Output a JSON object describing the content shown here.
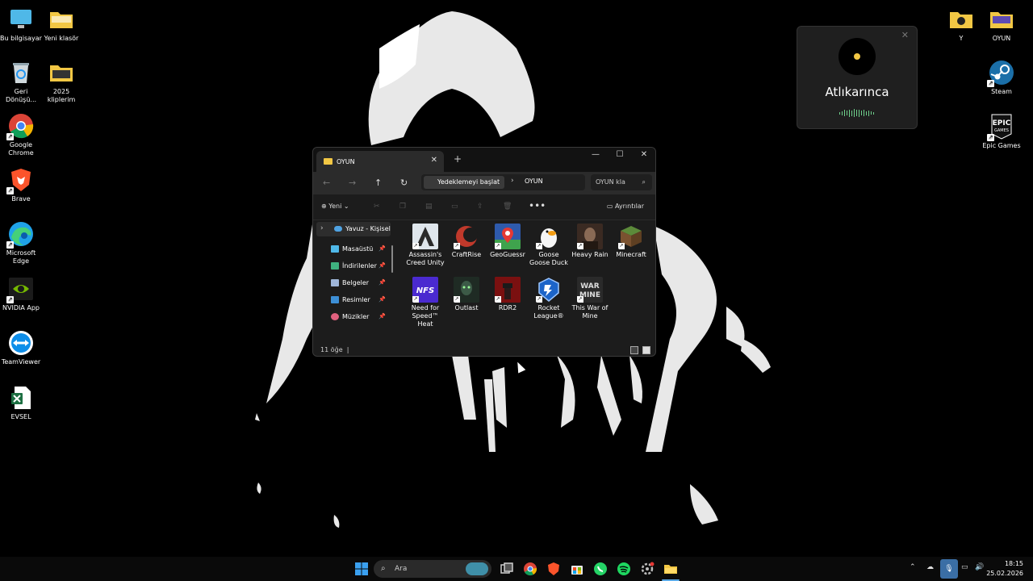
{
  "desktop": {
    "left_icons": [
      {
        "label": "Bu bilgisayar",
        "icon": "monitor-icon",
        "color": "#4fb8e8"
      },
      {
        "label": "Yeni klasör",
        "icon": "folder-icon",
        "color": "#f2c744"
      },
      {
        "label": "Geri Dönüşü...",
        "icon": "recycle-bin-icon",
        "color": "#cfd8dc"
      },
      {
        "label": "2025 kliplerim",
        "icon": "folder-icon",
        "color": "#f2c744"
      },
      {
        "label": "Google Chrome",
        "icon": "chrome-icon",
        "color": "#34a853"
      },
      {
        "label": "Brave",
        "icon": "brave-icon",
        "color": "#fb542b"
      },
      {
        "label": "Microsoft Edge",
        "icon": "edge-icon",
        "color": "#1fa2e8"
      },
      {
        "label": "NVIDIA App",
        "icon": "nvidia-icon",
        "color": "#76b900"
      },
      {
        "label": "TeamViewer",
        "icon": "teamviewer-icon",
        "color": "#0e8ee9"
      },
      {
        "label": "EVSEL",
        "icon": "excel-icon",
        "color": "#1d6f42"
      }
    ],
    "right_icons": [
      {
        "label": "Y",
        "icon": "folder-icon",
        "color": "#f2c744"
      },
      {
        "label": "OYUN",
        "icon": "folder-icon",
        "color": "#f2c744"
      },
      {
        "label": "Steam",
        "icon": "steam-icon",
        "color": "#1b6fa8"
      },
      {
        "label": "Epic Games",
        "icon": "epic-games-icon",
        "color": "#ffffff",
        "logo_text": "EPIC\nGAMES"
      }
    ]
  },
  "media_card": {
    "title": "Atlıkarınca",
    "close": "✕",
    "accent": "#f2c744",
    "wave_color": "#6fd08c"
  },
  "explorer": {
    "tab_title": "OYUN",
    "new_tab": "+",
    "tab_close": "✕",
    "window_controls": {
      "minimize": "—",
      "maximize": "☐",
      "close": "✕"
    },
    "breadcrumb": {
      "root": "Yedeklemeyi başlat",
      "separator": "›",
      "current": "OYUN"
    },
    "search_placeholder": "OYUN kla",
    "toolbar": {
      "new_label": "Yeni",
      "more": "•••",
      "details_label": "Ayrıntılar"
    },
    "sidebar": {
      "home": "Yavuz - Kişisel",
      "items": [
        {
          "label": "Masaüstü",
          "color": "#4fb8e8"
        },
        {
          "label": "İndirilenler",
          "color": "#3fb27f"
        },
        {
          "label": "Belgeler",
          "color": "#9fb6d9"
        },
        {
          "label": "Resimler",
          "color": "#3d8fd6"
        },
        {
          "label": "Müzikler",
          "color": "#e0607e"
        }
      ]
    },
    "files": [
      {
        "label": "Assassin's Creed Unity",
        "color": "#dfe6ec"
      },
      {
        "label": "CraftRise",
        "color": "#c0392b"
      },
      {
        "label": "GeoGuessr",
        "color": "#2e5aac"
      },
      {
        "label": "Goose Goose Duck",
        "color": "#f5f5f5"
      },
      {
        "label": "Heavy Rain",
        "color": "#3a2a22"
      },
      {
        "label": "Minecraft",
        "color": "#5c8a3a"
      },
      {
        "label": "Need for Speed™ Heat",
        "color": "#3b2aa8",
        "logo_text": "NFS"
      },
      {
        "label": "Outlast",
        "color": "#1f2b24"
      },
      {
        "label": "RDR2",
        "color": "#9e1b1b"
      },
      {
        "label": "Rocket League®",
        "color": "#1c64c8"
      },
      {
        "label": "This War of Mine",
        "color": "#d9d9d9",
        "logo_text": "WAR\nMINE"
      }
    ],
    "status": {
      "count": "11 öğe",
      "separator": "|"
    }
  },
  "taskbar": {
    "search_label": "Ara",
    "clock_time": "18:15",
    "clock_date": "25.02.2026",
    "apps": [
      {
        "name": "start-icon",
        "color": "#3aa0f0"
      },
      {
        "name": "task-view-icon",
        "color": "#cfcfcf"
      },
      {
        "name": "chrome-icon",
        "color": "#34a853"
      },
      {
        "name": "brave-icon",
        "color": "#fb542b"
      },
      {
        "name": "store-icon",
        "color": "#e8e8e8"
      },
      {
        "name": "whatsapp-icon",
        "color": "#25d366"
      },
      {
        "name": "spotify-icon",
        "color": "#1ed760"
      },
      {
        "name": "settings-icon",
        "color": "#bdbdbd"
      },
      {
        "name": "file-explorer-icon",
        "color": "#f2c744"
      }
    ]
  }
}
